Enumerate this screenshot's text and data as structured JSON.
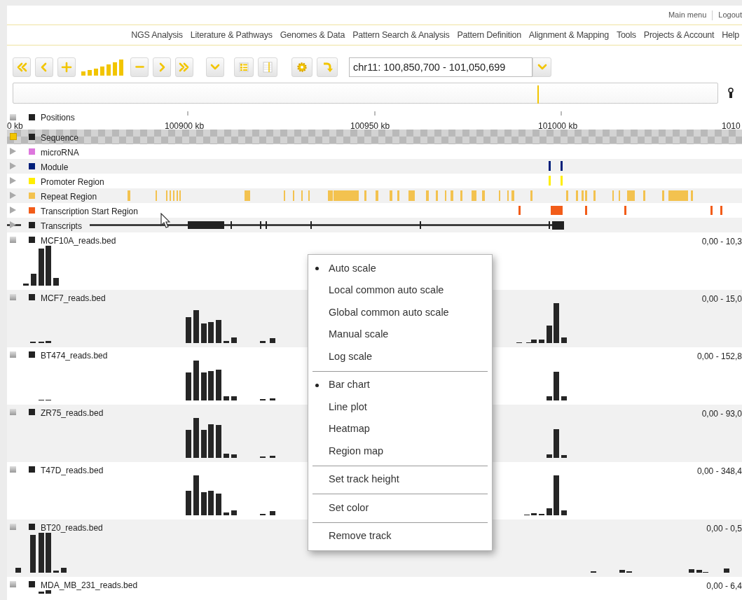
{
  "top_links": [
    "Main menu",
    "Logout"
  ],
  "nav": [
    "NGS Analysis",
    "Literature & Pathways",
    "Genomes & Data",
    "Pattern Search & Analysis",
    "Pattern Definition",
    "Alignment & Mapping",
    "Tools",
    "Projects & Account",
    "Help"
  ],
  "toolbar": {
    "location": "chr11: 100,850,700 - 101,050,699"
  },
  "ruler": {
    "label": "Positions",
    "ticks": [
      "0 kb",
      "100900 kb",
      "100950 kb",
      "101000 kb",
      "1010"
    ]
  },
  "feature_tracks": [
    {
      "label": "Sequence",
      "kind": "sequence",
      "color": "#222222"
    },
    {
      "label": "microRNA",
      "kind": "feature",
      "color": "#dd77dd"
    },
    {
      "label": "Module",
      "kind": "feature",
      "color": "#001f7a"
    },
    {
      "label": "Promoter Region",
      "kind": "feature",
      "color": "#ffee00"
    },
    {
      "label": "Repeat Region",
      "kind": "feature",
      "color": "#f3c24f"
    },
    {
      "label": "Transcription Start Region",
      "kind": "feature",
      "color": "#f25c19"
    },
    {
      "label": "Transcripts",
      "kind": "transcripts",
      "color": "#222222"
    }
  ],
  "read_tracks": [
    {
      "label": "MCF10A_reads.bed",
      "range": "0,00 - 10,3"
    },
    {
      "label": "MCF7_reads.bed",
      "range": "0,00 - 15,0"
    },
    {
      "label": "BT474_reads.bed",
      "range": "0,00 - 152,8"
    },
    {
      "label": "ZR75_reads.bed",
      "range": "0,00 - 93,0"
    },
    {
      "label": "T47D_reads.bed",
      "range": "0,00 - 348,4"
    },
    {
      "label": "BT20_reads.bed",
      "range": "0,00 - 0,5"
    },
    {
      "label": "MDA_MB_231_reads.bed",
      "range": "0,00 - 6,4"
    }
  ],
  "context_menu": {
    "sections": [
      {
        "items": [
          {
            "label": "Auto scale",
            "selected": true
          },
          {
            "label": "Local common auto scale",
            "selected": false
          },
          {
            "label": "Global common auto scale",
            "selected": false
          },
          {
            "label": "Manual scale",
            "selected": false
          },
          {
            "label": "Log scale",
            "selected": false
          }
        ]
      },
      {
        "items": [
          {
            "label": "Bar chart",
            "selected": true
          },
          {
            "label": "Line plot",
            "selected": false
          },
          {
            "label": "Heatmap",
            "selected": false
          },
          {
            "label": "Region map",
            "selected": false
          }
        ]
      },
      {
        "items": [
          {
            "label": "Set track height",
            "selected": false
          }
        ]
      },
      {
        "items": [
          {
            "label": "Set color",
            "selected": false
          }
        ]
      },
      {
        "items": [
          {
            "label": "Remove track",
            "selected": false
          }
        ]
      }
    ]
  }
}
